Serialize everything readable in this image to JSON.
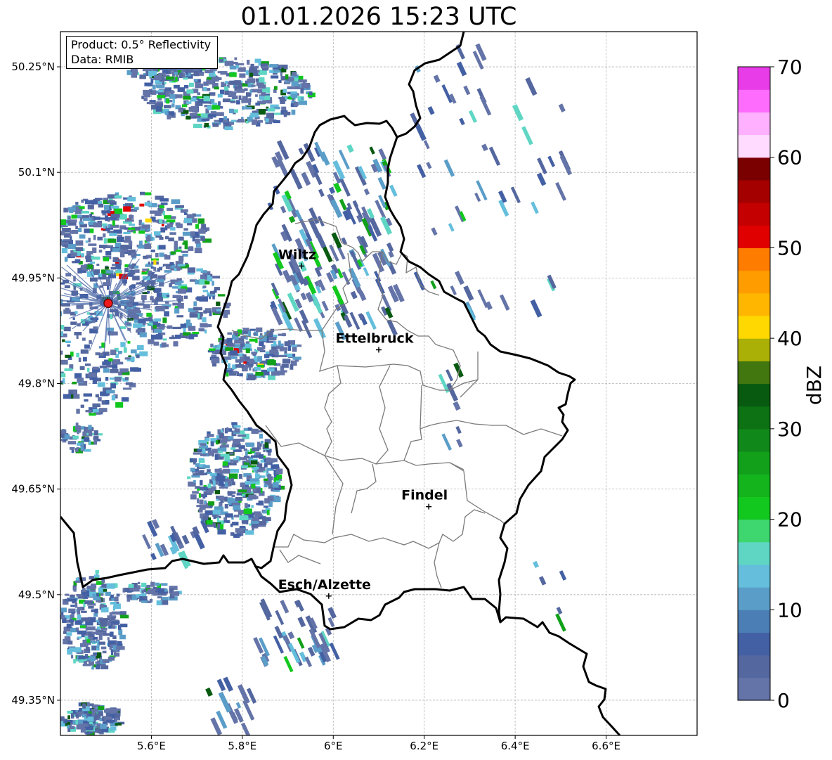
{
  "title": "01.01.2026 15:23 UTC",
  "info_box": {
    "product": "Product: 0.5° Reflectivity",
    "source": "Data: RMIB"
  },
  "map": {
    "lon_range": [
      5.4,
      6.8
    ],
    "lat_range": [
      49.3,
      50.3
    ],
    "lon_ticks": [
      {
        "value": 5.6,
        "label": "5.6°E"
      },
      {
        "value": 5.8,
        "label": "5.8°E"
      },
      {
        "value": 6.0,
        "label": "6°E"
      },
      {
        "value": 6.2,
        "label": "6.2°E"
      },
      {
        "value": 6.4,
        "label": "6.4°E"
      },
      {
        "value": 6.6,
        "label": "6.6°E"
      }
    ],
    "lat_ticks": [
      {
        "value": 49.35,
        "label": "49.35°N"
      },
      {
        "value": 49.5,
        "label": "49.5°N"
      },
      {
        "value": 49.65,
        "label": "49.65°N"
      },
      {
        "value": 49.8,
        "label": "49.8°N"
      },
      {
        "value": 49.95,
        "label": "49.95°N"
      },
      {
        "value": 50.1,
        "label": "50.1°N"
      },
      {
        "value": 50.25,
        "label": "50.25°N"
      }
    ],
    "grid": true,
    "cities": [
      {
        "name": "Wiltz",
        "lon": 5.93,
        "lat": 49.967
      },
      {
        "name": "Ettelbruck",
        "lon": 6.1,
        "lat": 49.848
      },
      {
        "name": "Findel",
        "lon": 6.21,
        "lat": 49.625
      },
      {
        "name": "Esch/Alzette",
        "lon": 5.99,
        "lat": 49.498
      }
    ],
    "radar_site": {
      "lon": 5.505,
      "lat": 49.914
    }
  },
  "colorbar": {
    "label": "dBZ",
    "vmin": 0,
    "vmax": 70,
    "ticks": [
      0,
      10,
      20,
      30,
      40,
      50,
      60,
      70
    ],
    "colors": [
      "#6474a8",
      "#54679f",
      "#4460a4",
      "#4b7eb4",
      "#5a9dc8",
      "#64bedc",
      "#5fd6c4",
      "#3ed66e",
      "#12c81e",
      "#14b41c",
      "#12a01a",
      "#10881a",
      "#0c7214",
      "#085a10",
      "#42760e",
      "#aab006",
      "#fed800",
      "#feb600",
      "#fe9c00",
      "#fe7c00",
      "#e00000",
      "#c40000",
      "#a40000",
      "#7a0000",
      "#ffdcff",
      "#ffb0ff",
      "#fe6cfe",
      "#e83ce8"
    ]
  }
}
